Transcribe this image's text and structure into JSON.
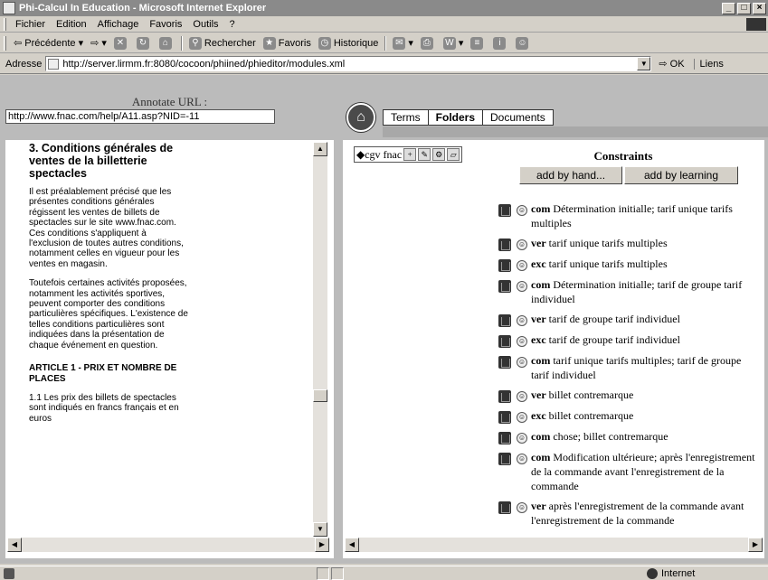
{
  "window": {
    "title": "Phi-Calcul In Education - Microsoft Internet Explorer"
  },
  "menu": [
    "Fichier",
    "Edition",
    "Affichage",
    "Favoris",
    "Outils",
    "?"
  ],
  "toolbar": {
    "back": "Précédente",
    "search": "Rechercher",
    "favorites": "Favoris",
    "history": "Historique"
  },
  "address": {
    "label": "Adresse",
    "url": "http://server.lirmm.fr:8080/cocoon/phiined/phieditor/modules.xml",
    "go": "OK",
    "links": "Liens"
  },
  "left": {
    "annotate_label": "Annotate URL :",
    "annotate_url": "http://www.fnac.com/help/A11.asp?NID=-11",
    "heading": "3. Conditions générales de ventes de la billetterie spectacles",
    "paragraphs": [
      "Il est préalablement précisé que les présentes conditions générales régissent les ventes de billets de spectacles sur le site www.fnac.com. Ces conditions s'appliquent à l'exclusion de toutes autres conditions, notamment celles en vigueur pour les ventes en magasin.",
      "Toutefois certaines activités proposées, notamment les activités sportives, peuvent comporter des conditions particulières spécifiques. L'existence de telles conditions particulières sont indiquées dans la présentation de chaque événement en question."
    ],
    "article": "ARTICLE 1 - PRIX ET NOMBRE DE PLACES",
    "article_text": "1.1 Les prix des billets de spectacles sont indiqués en francs français et en euros"
  },
  "right": {
    "tabs": [
      "Terms",
      "Folders",
      "Documents"
    ],
    "active_tab": "Folders",
    "folder_label": "cgv fnac",
    "constraints_title": "Constraints",
    "add_by_hand": "add by hand...",
    "add_by_learning": "add by learning",
    "constraints": [
      {
        "kw": "com",
        "text": "Détermination initialle; tarif unique tarifs multiples"
      },
      {
        "kw": "ver",
        "text": "tarif unique tarifs multiples"
      },
      {
        "kw": "exc",
        "text": "tarif unique tarifs multiples"
      },
      {
        "kw": "com",
        "text": "Détermination initialle; tarif de groupe tarif individuel"
      },
      {
        "kw": "ver",
        "text": "tarif de groupe tarif individuel"
      },
      {
        "kw": "exc",
        "text": "tarif de groupe tarif individuel"
      },
      {
        "kw": "com",
        "text": "tarif unique tarifs multiples; tarif de groupe tarif individuel"
      },
      {
        "kw": "ver",
        "text": "billet contremarque"
      },
      {
        "kw": "exc",
        "text": "billet contremarque"
      },
      {
        "kw": "com",
        "text": "chose; billet contremarque"
      },
      {
        "kw": "com",
        "text": "Modification ultérieure; après l'enregistrement de la commande avant l'enregistrement de la commande"
      },
      {
        "kw": "ver",
        "text": "après l'enregistrement de la commande avant l'enregistrement de la commande"
      }
    ]
  },
  "status": {
    "zone": "Internet"
  }
}
